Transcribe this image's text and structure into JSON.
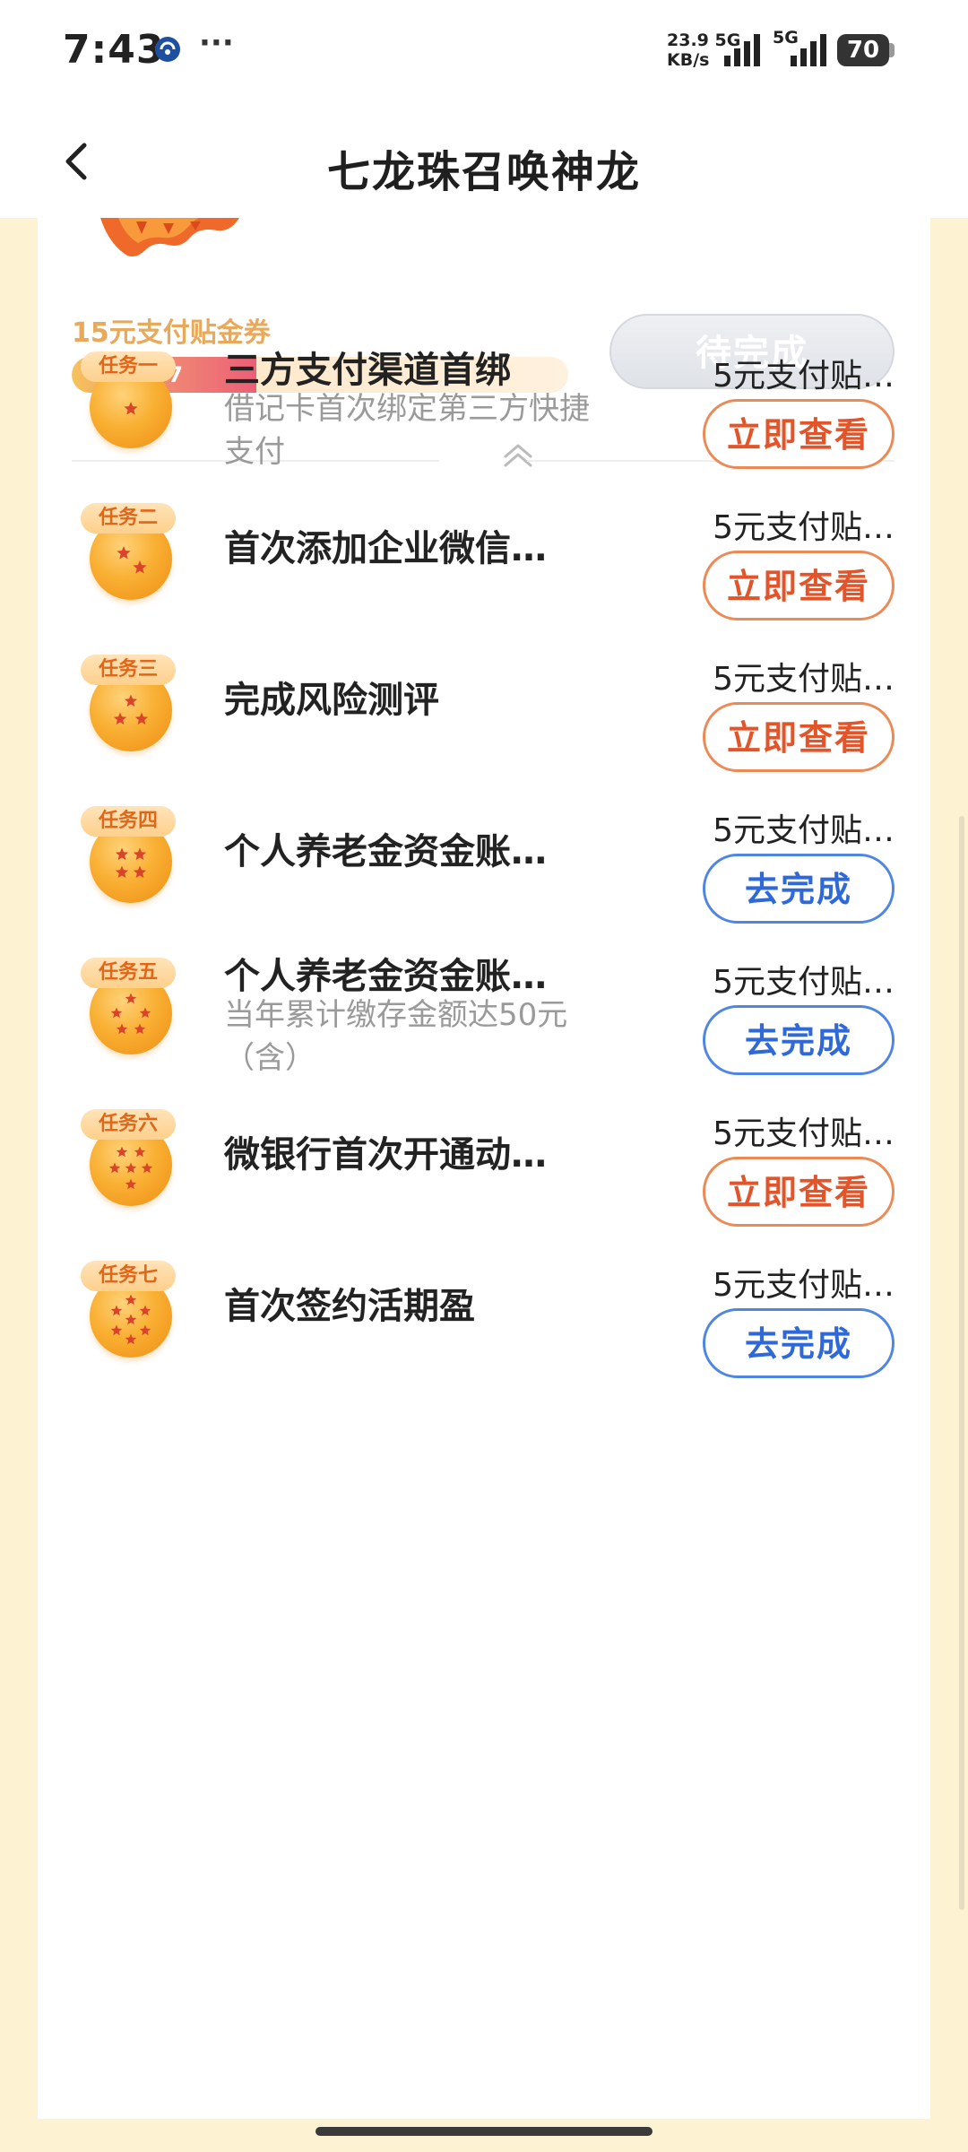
{
  "status_bar": {
    "time": "7:43",
    "dots": "···",
    "speed_value": "23.9",
    "speed_unit": "KB/s",
    "net1": "5G",
    "net2": "5G",
    "battery": "70"
  },
  "header": {
    "title": "七龙珠召唤神龙"
  },
  "summary": {
    "reward_label": "15元支付贴金券",
    "progress_text": "4/7",
    "progress_fraction": 0.5714,
    "pending_label": "待完成"
  },
  "tasks": [
    {
      "tag": "任务一",
      "stars": 1,
      "title": "三方支付渠道首绑",
      "desc": "借记卡首次绑定第三方快捷支付",
      "reward": "5元支付贴…",
      "button": "立即查看"
    },
    {
      "tag": "任务二",
      "stars": 2,
      "title": "首次添加企业微信…",
      "desc": "",
      "reward": "5元支付贴…",
      "button": "立即查看"
    },
    {
      "tag": "任务三",
      "stars": 3,
      "title": "完成风险测评",
      "desc": "",
      "reward": "5元支付贴…",
      "button": "立即查看"
    },
    {
      "tag": "任务四",
      "stars": 4,
      "title": "个人养老金资金账…",
      "desc": "",
      "reward": "5元支付贴…",
      "button": "去完成"
    },
    {
      "tag": "任务五",
      "stars": 5,
      "title": "个人养老金资金账…",
      "desc": "当年累计缴存金额达50元（含）",
      "reward": "5元支付贴…",
      "button": "去完成"
    },
    {
      "tag": "任务六",
      "stars": 6,
      "title": "微银行首次开通动…",
      "desc": "",
      "reward": "5元支付贴…",
      "button": "立即查看"
    },
    {
      "tag": "任务七",
      "stars": 7,
      "title": "首次签约活期盈",
      "desc": "",
      "reward": "5元支付贴…",
      "button": "去完成"
    }
  ],
  "colors": {
    "page_bg": "#fdf3d2",
    "accent_orange": "#e2552a",
    "accent_blue": "#2f69d8",
    "reward_text": "#e8a95a"
  }
}
